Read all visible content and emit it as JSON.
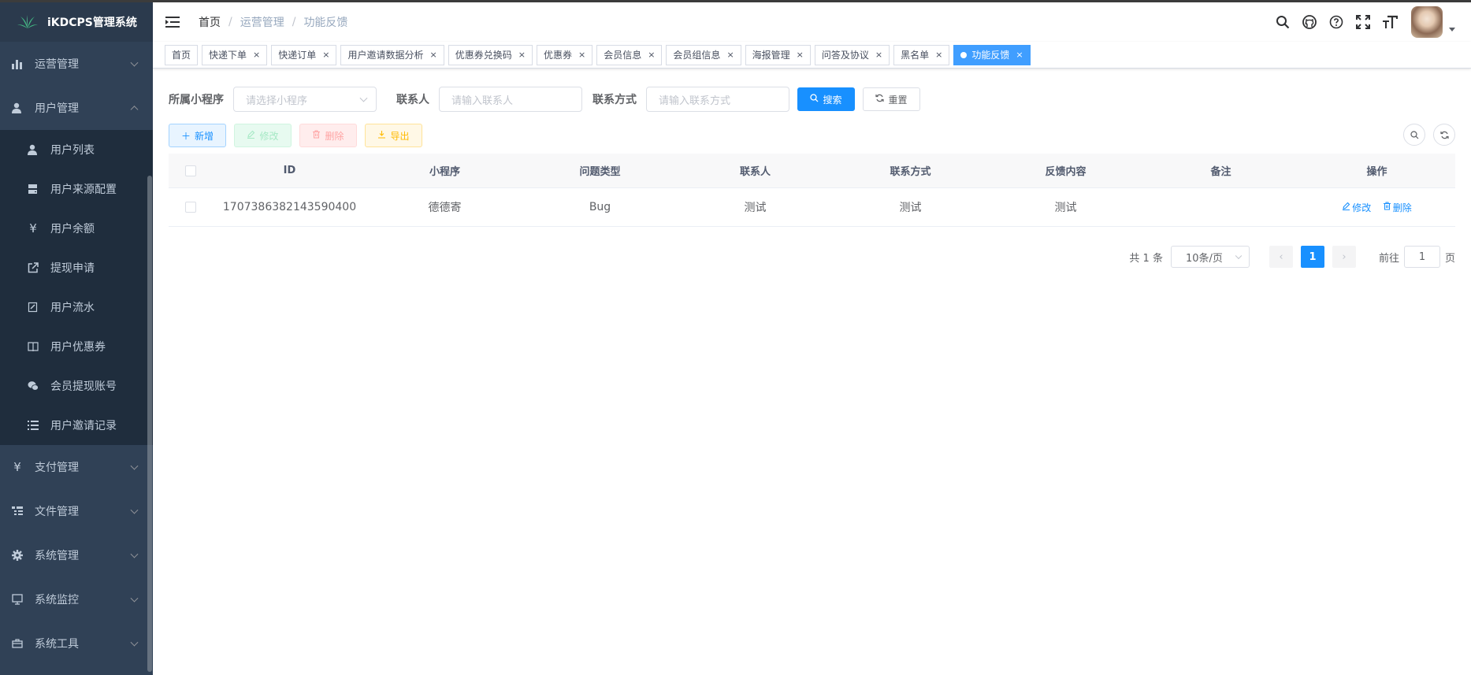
{
  "app": {
    "title": "iKDCPS管理系统"
  },
  "sidebar": {
    "items": [
      {
        "label": "运营管理",
        "icon": "bar-chart-icon",
        "expanded": false
      },
      {
        "label": "用户管理",
        "icon": "user-icon",
        "expanded": true,
        "children": [
          {
            "label": "用户列表",
            "icon": "user-icon"
          },
          {
            "label": "用户来源配置",
            "icon": "server-icon"
          },
          {
            "label": "用户余额",
            "icon": "yen-icon"
          },
          {
            "label": "提现申请",
            "icon": "external-link-icon"
          },
          {
            "label": "用户流水",
            "icon": "edit-doc-icon"
          },
          {
            "label": "用户优惠券",
            "icon": "book-icon"
          },
          {
            "label": "会员提现账号",
            "icon": "wechat-icon"
          },
          {
            "label": "用户邀请记录",
            "icon": "list-icon"
          }
        ]
      },
      {
        "label": "支付管理",
        "icon": "yen-icon",
        "expanded": false
      },
      {
        "label": "文件管理",
        "icon": "tree-table-icon",
        "expanded": false
      },
      {
        "label": "系统管理",
        "icon": "gear-icon",
        "expanded": false
      },
      {
        "label": "系统监控",
        "icon": "monitor-icon",
        "expanded": false
      },
      {
        "label": "系统工具",
        "icon": "toolbox-icon",
        "expanded": false
      }
    ]
  },
  "breadcrumb": {
    "home": "首页",
    "level1": "运营管理",
    "current": "功能反馈",
    "sep": "/"
  },
  "tags": [
    {
      "label": "首页",
      "closable": false,
      "active": false
    },
    {
      "label": "快递下单",
      "closable": true,
      "active": false
    },
    {
      "label": "快递订单",
      "closable": true,
      "active": false
    },
    {
      "label": "用户邀请数据分析",
      "closable": true,
      "active": false
    },
    {
      "label": "优惠券兑换码",
      "closable": true,
      "active": false
    },
    {
      "label": "优惠券",
      "closable": true,
      "active": false
    },
    {
      "label": "会员信息",
      "closable": true,
      "active": false
    },
    {
      "label": "会员组信息",
      "closable": true,
      "active": false
    },
    {
      "label": "海报管理",
      "closable": true,
      "active": false
    },
    {
      "label": "问答及协议",
      "closable": true,
      "active": false
    },
    {
      "label": "黑名单",
      "closable": true,
      "active": false
    },
    {
      "label": "功能反馈",
      "closable": true,
      "active": true
    }
  ],
  "tag_close": "×",
  "search": {
    "app_label": "所属小程序",
    "app_placeholder": "请选择小程序",
    "contact_label": "联系人",
    "contact_placeholder": "请输入联系人",
    "way_label": "联系方式",
    "way_placeholder": "请输入联系方式",
    "search_btn": "搜索",
    "reset_btn": "重置"
  },
  "actions": {
    "add": "新增",
    "edit": "修改",
    "delete": "删除",
    "export": "导出"
  },
  "table": {
    "headers": [
      "ID",
      "小程序",
      "问题类型",
      "联系人",
      "联系方式",
      "反馈内容",
      "备注",
      "操作"
    ],
    "rows": [
      {
        "id": "1707386382143590400",
        "app": "德德寄",
        "type": "Bug",
        "contact": "测试",
        "way": "测试",
        "content": "测试",
        "remark": "",
        "op_edit": "修改",
        "op_delete": "删除"
      }
    ]
  },
  "pagination": {
    "total": "共 1 条",
    "page_size": "10条/页",
    "current": "1",
    "goto_prefix": "前往",
    "goto_value": "1",
    "goto_suffix": "页"
  },
  "colors": {
    "sidebar_bg": "#304156",
    "primary": "#1890ff",
    "active_tag": "#409eff"
  }
}
